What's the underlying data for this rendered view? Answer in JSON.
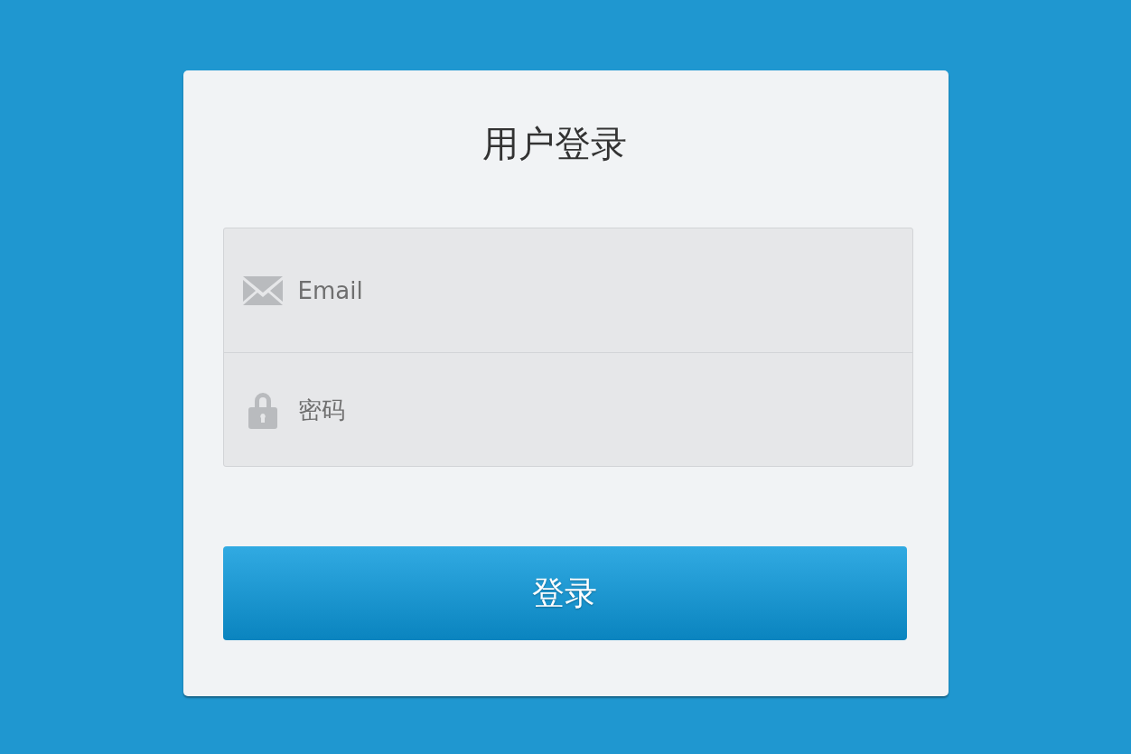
{
  "title": "用户登录",
  "fields": [
    {
      "kind": "email",
      "placeholder": "Email"
    },
    {
      "kind": "password",
      "placeholder": "密码"
    }
  ],
  "submit_button": "登录"
}
